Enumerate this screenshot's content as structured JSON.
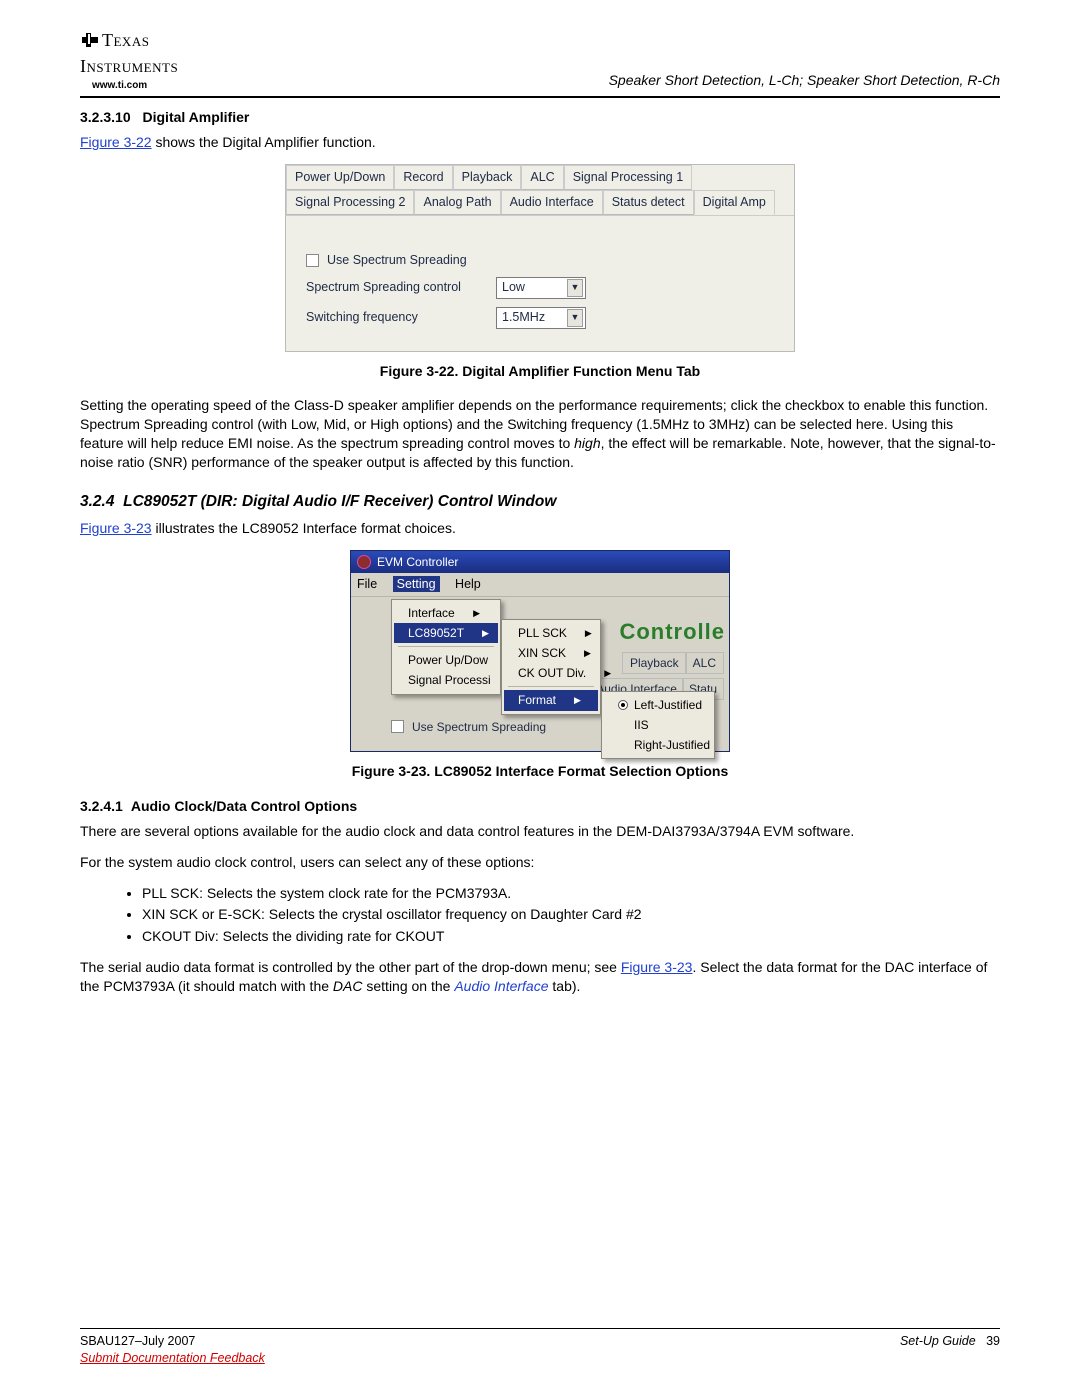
{
  "logo": {
    "brand_line1": "Texas",
    "brand_line2": "Instruments",
    "url": "www.ti.com"
  },
  "header_right": "Speaker Short Detection, L-Ch; Speaker Short Detection, R-Ch",
  "sec_32310": {
    "num": "3.2.3.10",
    "title": "Digital Amplifier"
  },
  "intro_22_pre": "Figure 3-22",
  "intro_22_post": " shows the Digital Amplifier function.",
  "fig22": {
    "tabs_row1": [
      "Power Up/Down",
      "Record",
      "Playback",
      "ALC",
      "Signal Processing 1"
    ],
    "tabs_row2": [
      "Signal Processing 2",
      "Analog Path",
      "Audio Interface",
      "Status detect",
      "Digital Amp"
    ],
    "checkbox_label": "Use Spectrum Spreading",
    "row2_label": "Spectrum Spreading control",
    "row2_value": "Low",
    "row3_label": "Switching frequency",
    "row3_value": "1.5MHz",
    "caption": "Figure 3-22. Digital Amplifier Function Menu Tab"
  },
  "para_after_22_a": "Setting the operating speed of the Class-D speaker amplifier depends on the performance requirements; click the checkbox to enable this function. Spectrum Spreading control (with Low, Mid, or High options) and the Switching frequency (1.5MHz to 3MHz) can be selected here. Using this feature will help reduce EMI noise. As the spectrum spreading control moves to ",
  "para_after_22_high": "high",
  "para_after_22_b": ", the effect will be remarkable. Note, however, that the signal-to-noise ratio (SNR) performance of the speaker output is affected by this function.",
  "sec_324": {
    "num": "3.2.4",
    "title": "LC89052T (DIR: Digital Audio I/F Receiver) Control Window"
  },
  "intro_23_pre": "Figure 3-23",
  "intro_23_post": " illustrates the LC89052 Interface format choices.",
  "fig23": {
    "win_title": "EVM Controller",
    "menubar": [
      "File",
      "Setting",
      "Help"
    ],
    "menu_setting": {
      "items": [
        "Interface",
        "LC89052T"
      ],
      "below": [
        "Power Up/Dow",
        "Signal Processi"
      ]
    },
    "submenu_lc": [
      "PLL SCK",
      "XIN SCK",
      "CK OUT Div.",
      "Format"
    ],
    "submenu_format": [
      "Left-Justified",
      "IIS",
      "Right-Justified"
    ],
    "bg_logo": "Controlle",
    "bg_tabs": [
      "Playback",
      "ALC"
    ],
    "bg_tabs2": [
      "Audio Interface",
      "Statu"
    ],
    "spectrum_label": "Use Spectrum Spreading",
    "caption": "Figure 3-23. LC89052 Interface Format Selection Options"
  },
  "sec_3241": {
    "num": "3.2.4.1",
    "title": "Audio Clock/Data Control Options"
  },
  "para_3241_a": "There are several options available for the audio clock and data control features in the DEM-DAI3793A/3794A EVM software.",
  "para_3241_b": "For the system audio clock control, users can select any of these options:",
  "bullets": [
    "PLL SCK: Selects the system clock rate for the PCM3793A.",
    "XIN SCK or E-SCK: Selects the crystal oscillator frequency on Daughter Card #2",
    "CKOUT Div: Selects the dividing rate for CKOUT"
  ],
  "para_3241_c1": "The serial audio data format is controlled by the other part of the drop-down menu; see ",
  "para_3241_c_link": "Figure 3-23",
  "para_3241_c2": ". Select the data format for the DAC interface of the PCM3793A (it should match with the ",
  "para_3241_dac": "DAC",
  "para_3241_c3": " setting on the ",
  "para_3241_ai": "Audio Interface",
  "para_3241_c4": " tab).",
  "footer": {
    "left_doc": "SBAU127",
    "left_sep": "–",
    "left_date": "July 2007",
    "feedback": "Submit Documentation Feedback",
    "right_title": "Set-Up Guide",
    "page": "39"
  }
}
